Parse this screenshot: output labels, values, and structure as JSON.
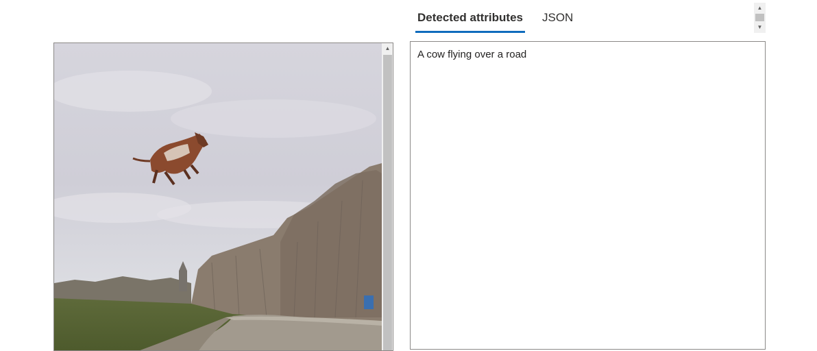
{
  "tabs": [
    {
      "label": "Detected attributes",
      "active": true
    },
    {
      "label": "JSON",
      "active": false
    }
  ],
  "result": {
    "caption": "A cow flying over a road"
  },
  "image": {
    "subject": "flying-cow-over-road-photo"
  },
  "colors": {
    "accent": "#0f6cbd",
    "border": "#8a8886",
    "scroll_thumb": "#c1c1c1"
  }
}
